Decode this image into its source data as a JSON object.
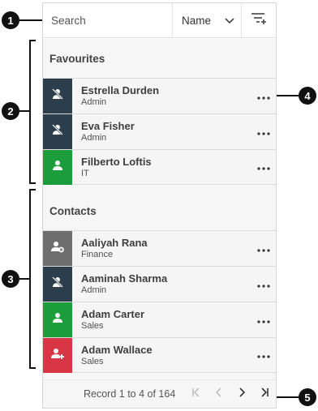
{
  "toolbar": {
    "search_placeholder": "Search",
    "sort_label": "Name"
  },
  "sections": {
    "favourites": {
      "title": "Favourites",
      "items": [
        {
          "name": "Estrella Durden",
          "role": "Admin"
        },
        {
          "name": "Eva Fisher",
          "role": "Admin"
        },
        {
          "name": "Filberto Loftis",
          "role": "IT"
        }
      ]
    },
    "contacts": {
      "title": "Contacts",
      "items": [
        {
          "name": "Aaliyah Rana",
          "role": "Finance"
        },
        {
          "name": "Aaminah Sharma",
          "role": "Admin"
        },
        {
          "name": "Adam Carter",
          "role": "Sales"
        },
        {
          "name": "Adam Wallace",
          "role": "Sales"
        }
      ]
    }
  },
  "pagination": {
    "record_text": "Record 1 to 4 of 164"
  },
  "callouts": [
    "1",
    "2",
    "3",
    "4",
    "5"
  ],
  "colors": {
    "avatar_dark": "#2c3e4c",
    "avatar_green": "#1a9d3a",
    "avatar_gray": "#6e6e6e",
    "avatar_red": "#d83645",
    "row_background": "#f5f5f5"
  },
  "icons": {
    "sort": "chevron-down-icon",
    "filter": "filter-add-icon",
    "presence_off": "user-off-icon",
    "presence_on": "user-icon",
    "presence_away": "user-away-icon",
    "presence_add": "user-add-icon",
    "more": "more-horizontal-icon",
    "pager": [
      "first-page-icon",
      "previous-page-icon",
      "next-page-icon",
      "last-page-icon"
    ]
  }
}
